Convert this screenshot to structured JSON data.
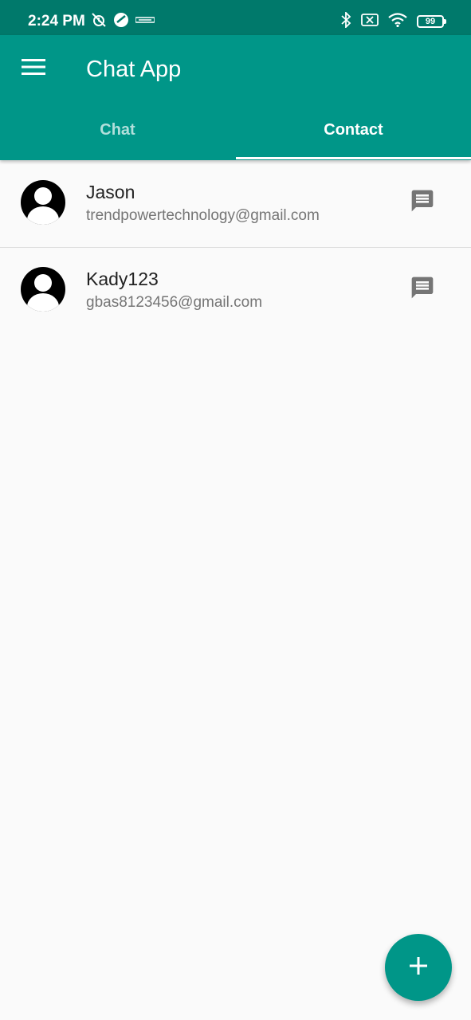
{
  "status_bar": {
    "time": "2:24 PM",
    "battery": "99",
    "left_icons": [
      "alarm-off-icon",
      "app-notification-icon",
      "brand-notification-icon"
    ],
    "right_icons": [
      "bluetooth-icon",
      "no-sim-icon",
      "wifi-icon",
      "battery-icon"
    ]
  },
  "app_bar": {
    "title": "Chat App",
    "menu_icon": "menu-icon",
    "background": "#009688"
  },
  "tabs": [
    {
      "label": "Chat",
      "selected": false
    },
    {
      "label": "Contact",
      "selected": true
    }
  ],
  "contacts": [
    {
      "name": "Jason",
      "email": "trendpowertechnology@gmail.com",
      "action_icon": "message-icon"
    },
    {
      "name": "Kady123",
      "email": "gbas8123456@gmail.com",
      "action_icon": "message-icon"
    }
  ],
  "fab": {
    "icon": "add-icon",
    "color": "#009688"
  },
  "colors": {
    "status_bar": "#00796b",
    "primary": "#009688",
    "background": "#fafafa"
  }
}
